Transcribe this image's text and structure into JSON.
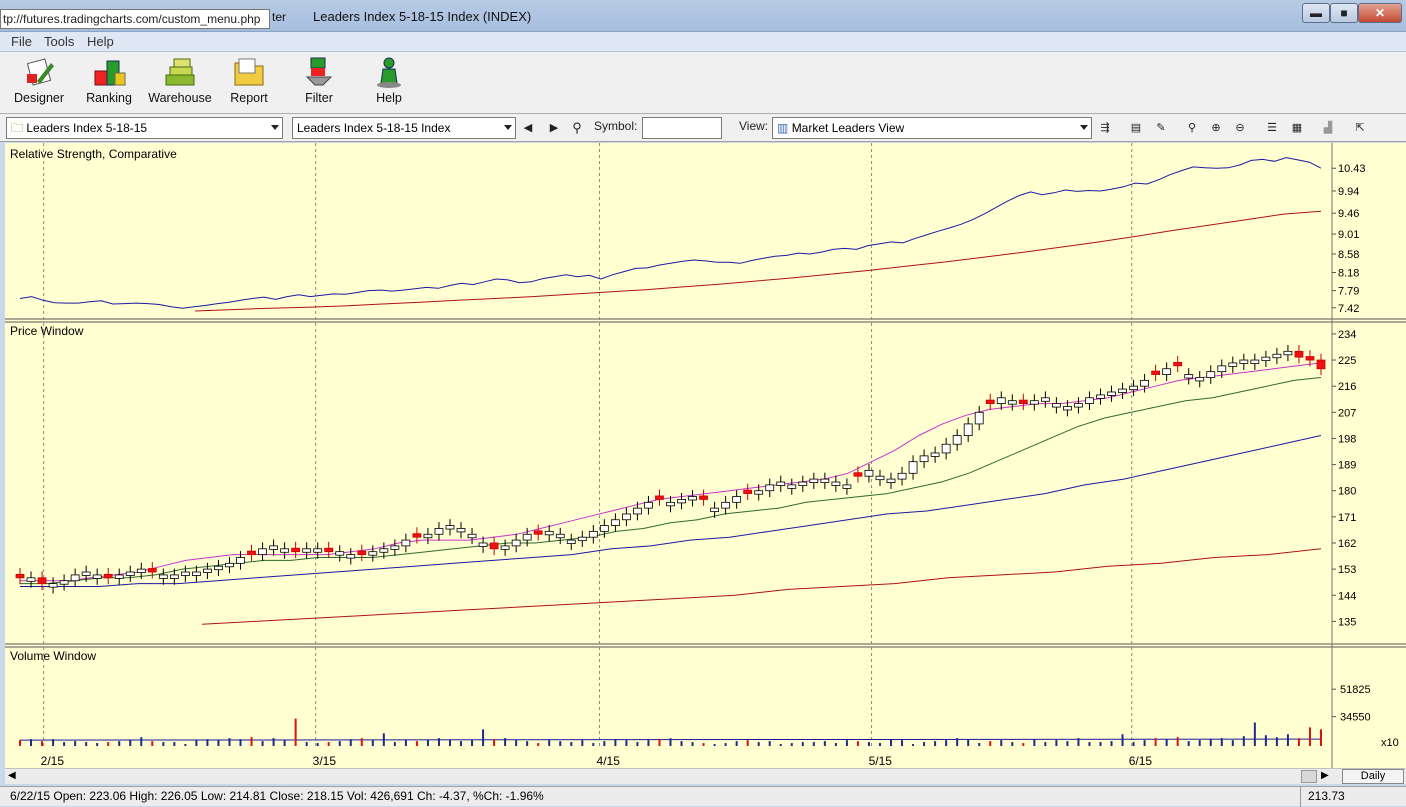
{
  "window": {
    "url_tooltip": "tp://futures.tradingcharts.com/custom_menu.php",
    "title_prefix": "ter",
    "title": "Leaders Index 5-18-15 Index (INDEX)",
    "min_label": "▬",
    "max_label": "■",
    "close_label": "✕"
  },
  "menu": [
    "File",
    "Tools",
    "Help"
  ],
  "toolbar": [
    {
      "label": "Designer",
      "icon": "designer-icon"
    },
    {
      "label": "Ranking",
      "icon": "ranking-icon"
    },
    {
      "label": "Warehouse",
      "icon": "warehouse-icon"
    },
    {
      "label": "Report",
      "icon": "report-icon"
    },
    {
      "label": "Filter",
      "icon": "filter-icon"
    },
    {
      "label": "Help",
      "icon": "help-icon"
    }
  ],
  "selectbar": {
    "list_value": "Leaders Index 5-18-15",
    "index_value": "Leaders Index 5-18-15 Index",
    "symbol_label": "Symbol:",
    "symbol_value": "",
    "view_label": "View:",
    "view_value": "Market Leaders View"
  },
  "chart_data": [
    {
      "type": "line",
      "title": "Relative Strength, Comparative",
      "y_ticks": [
        "10.43",
        "9.94",
        "9.46",
        "9.01",
        "8.58",
        "8.18",
        "7.79",
        "7.42"
      ],
      "ylim": [
        7.35,
        10.5
      ],
      "series": [
        {
          "color": "#1a1aa0",
          "values": [
            7.62,
            7.66,
            7.58,
            7.53,
            7.52,
            7.52,
            7.55,
            7.57,
            7.5,
            7.51,
            7.52,
            7.51,
            7.49,
            7.44,
            7.41,
            7.44,
            7.47,
            7.51,
            7.54,
            7.58,
            7.62,
            7.65,
            7.6,
            7.66,
            7.7,
            7.66,
            7.69,
            7.72,
            7.71,
            7.75,
            7.79,
            7.8,
            7.78,
            7.8,
            7.83,
            7.86,
            7.84,
            7.9,
            7.95,
            7.92,
            7.98,
            8.04,
            8.02,
            7.96,
            7.98,
            8.05,
            8.09,
            8.13,
            8.09,
            8.12,
            8.04,
            8.13,
            8.2,
            8.27,
            8.28,
            8.34,
            8.38,
            8.42,
            8.45,
            8.43,
            8.4,
            8.4,
            8.38,
            8.44,
            8.49,
            8.53,
            8.55,
            8.6,
            8.58,
            8.62,
            8.68,
            8.7,
            8.68,
            8.76,
            8.8,
            8.84,
            8.82,
            8.91,
            8.99,
            9.07,
            9.14,
            9.22,
            9.32,
            9.44,
            9.58,
            9.72,
            9.84,
            9.92,
            9.86,
            9.9,
            9.96,
            9.93,
            9.95,
            9.94,
            9.98,
            10.03,
            10.11,
            10.09,
            10.18,
            10.29,
            10.38,
            10.46,
            10.44,
            10.43,
            10.44,
            10.5,
            10.6,
            10.62,
            10.58,
            10.66,
            10.61,
            10.56,
            10.43
          ]
        },
        {
          "color": "#b01010",
          "values": [
            7.35,
            7.38,
            7.41,
            7.43,
            7.46,
            7.5,
            7.54,
            7.58,
            7.62,
            7.66,
            7.71,
            7.76,
            7.81,
            7.87,
            7.93,
            8.0,
            8.07,
            8.15,
            8.23,
            8.32,
            8.41,
            8.51,
            8.61,
            8.72,
            8.83,
            8.95,
            9.08,
            9.2,
            9.32,
            9.44,
            9.5
          ]
        }
      ]
    },
    {
      "type": "candlestick",
      "title": "Price Window",
      "y_ticks": [
        "234",
        "225",
        "216",
        "207",
        "198",
        "189",
        "180",
        "171",
        "162",
        "153",
        "144",
        "135"
      ],
      "ylim": [
        131,
        235
      ],
      "x_labels": [
        "2/15",
        "3/15",
        "4/15",
        "5/15",
        "6/15"
      ],
      "close_values": [
        150,
        150,
        148,
        148,
        149,
        151,
        152,
        151,
        150,
        151,
        152,
        153,
        152,
        151,
        151,
        152,
        152,
        153,
        154,
        155,
        157,
        158,
        160,
        161,
        160,
        159,
        160,
        160,
        159,
        159,
        158,
        158,
        159,
        160,
        161,
        163,
        164,
        165,
        167,
        168,
        167,
        165,
        162,
        160,
        161,
        163,
        165,
        165,
        166,
        165,
        163,
        164,
        166,
        168,
        170,
        172,
        174,
        176,
        177,
        176,
        177,
        178,
        177,
        174,
        176,
        178,
        179,
        180,
        182,
        183,
        182,
        183,
        184,
        184,
        183,
        182,
        185,
        187,
        185,
        184,
        186,
        190,
        192,
        193,
        196,
        199,
        203,
        207,
        210,
        212,
        211,
        210,
        211,
        212,
        210,
        209,
        210,
        212,
        213,
        214,
        215,
        216,
        218,
        220,
        222,
        223,
        220,
        219,
        221,
        223,
        224,
        225,
        225,
        226,
        227,
        228,
        226,
        225,
        222
      ],
      "bearish_candles": [
        0,
        2,
        8,
        12,
        21,
        25,
        28,
        31,
        36,
        43,
        47,
        58,
        62,
        66,
        76,
        88,
        91,
        103,
        105,
        116,
        117,
        118,
        119
      ],
      "series": [
        {
          "color": "#cc33cc",
          "values": [
            149,
            149,
            149,
            150,
            151,
            152,
            154,
            156,
            157,
            158,
            158,
            158,
            158,
            158,
            159,
            160,
            162,
            163,
            163,
            163,
            164,
            165,
            167,
            169,
            171,
            173,
            175,
            177,
            178,
            179,
            180,
            181,
            182,
            183,
            184,
            186,
            190,
            194,
            199,
            203,
            206,
            208,
            209,
            210,
            210,
            211,
            212,
            214,
            216,
            218,
            219,
            220,
            221,
            222,
            223,
            224
          ]
        },
        {
          "color": "#2e6b2e",
          "values": [
            148,
            148,
            149,
            150,
            150,
            151,
            153,
            154,
            155,
            156,
            156,
            157,
            157,
            157,
            158,
            159,
            160,
            161,
            162,
            162,
            163,
            164,
            166,
            167,
            169,
            170,
            172,
            173,
            174,
            176,
            177,
            178,
            179,
            181,
            183,
            186,
            190,
            194,
            198,
            202,
            205,
            207,
            209,
            211,
            212,
            214,
            216,
            218,
            219
          ]
        },
        {
          "color": "#1a1aa0",
          "values": [
            147,
            147,
            147,
            148,
            148,
            149,
            150,
            151,
            152,
            153,
            154,
            155,
            156,
            157,
            158,
            160,
            161,
            163,
            164,
            166,
            168,
            170,
            172,
            173,
            175,
            177,
            179,
            182,
            184,
            187,
            190,
            193,
            196,
            199
          ]
        },
        {
          "color": "#b01010",
          "values": [
            134,
            135,
            136,
            137,
            138,
            139,
            140,
            141,
            142,
            143,
            144,
            146,
            147,
            148,
            150,
            151,
            152,
            154,
            155,
            157,
            158,
            160
          ]
        }
      ]
    },
    {
      "type": "bar",
      "title": "Volume Window",
      "y_ticks": [
        "51825",
        "34550"
      ],
      "scale_label": "x10",
      "values": [
        6,
        7,
        5,
        7,
        4,
        5,
        4,
        3,
        4,
        5,
        6,
        9,
        5,
        4,
        4,
        2,
        6,
        7,
        6,
        8,
        7,
        9,
        5,
        8,
        6,
        28,
        4,
        3,
        4,
        5,
        7,
        8,
        6,
        13,
        4,
        6,
        5,
        6,
        8,
        6,
        5,
        6,
        17,
        7,
        8,
        6,
        5,
        3,
        6,
        5,
        4,
        6,
        3,
        5,
        7,
        6,
        4,
        6,
        7,
        8,
        5,
        4,
        3,
        2,
        3,
        5,
        6,
        4,
        5,
        2,
        3,
        4,
        4,
        5,
        3,
        6,
        5,
        4,
        3,
        7,
        6,
        2,
        4,
        5,
        6,
        8,
        7,
        3,
        5,
        6,
        4,
        3,
        7,
        4,
        6,
        5,
        8,
        4,
        4,
        5,
        12,
        4,
        6,
        8,
        7,
        9,
        5,
        6,
        7,
        8,
        6,
        10,
        24,
        11,
        9,
        12,
        8,
        19,
        17
      ],
      "ylim": [
        0,
        100
      ]
    }
  ],
  "scrollbar": {
    "period_label": "Daily"
  },
  "status": {
    "ohlc": "6/22/15 Open: 223.06 High: 226.05 Low: 214.81 Close: 218.15 Vol: 426,691 Ch: -4.37, %Ch: -1.96%",
    "cursor_value": "213.73"
  }
}
